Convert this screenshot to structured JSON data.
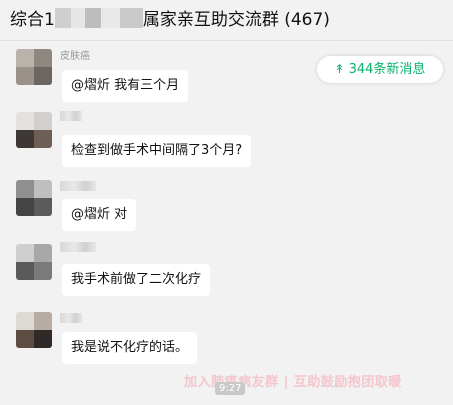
{
  "header": {
    "title_prefix": "综合1",
    "title_suffix": "属家亲互助交流群 (467)"
  },
  "new_messages": {
    "icon": "double-chevron-up-icon",
    "label": "344条新消息"
  },
  "messages": [
    {
      "sender": "皮肤癌",
      "text": "@熠炘 我有三个月"
    },
    {
      "sender": "",
      "text": "检查到做手术中间隔了3个月?"
    },
    {
      "sender": "",
      "text": "@熠炘 对"
    },
    {
      "sender": "",
      "text": "我手术前做了二次化疗"
    },
    {
      "sender": "",
      "text": "我是说不化疗的话。"
    }
  ],
  "watermark": "加入肺癌病友群 | 互助鼓励抱团取暖",
  "timestamp": "9:27",
  "colors": {
    "accent_green": "#07b36a",
    "bubble": "#ffffff",
    "background": "#f2f2f2"
  }
}
